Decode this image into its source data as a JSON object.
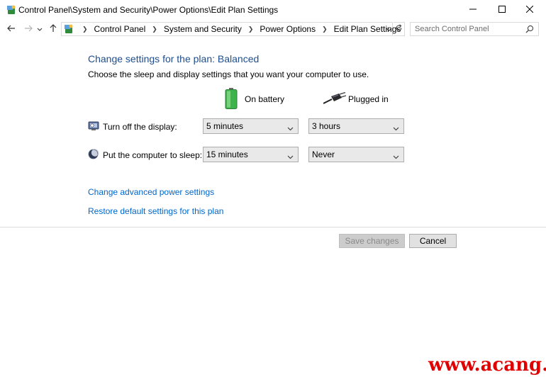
{
  "window": {
    "title": "Control Panel\\System and Security\\Power Options\\Edit Plan Settings",
    "app_icon": "control-panel-icon",
    "minimize_icon": "minimize-icon",
    "maximize_icon": "maximize-icon",
    "close_icon": "close-icon"
  },
  "navigation": {
    "back_icon": "arrow-left-icon",
    "forward_icon": "arrow-right-icon",
    "recent_icon": "chevron-down-icon",
    "up_icon": "arrow-up-icon",
    "breadcrumbs": [
      "Control Panel",
      "System and Security",
      "Power Options",
      "Edit Plan Settings"
    ],
    "refresh_icon": "refresh-icon",
    "search_placeholder": "Search Control Panel",
    "search_value": ""
  },
  "content": {
    "heading": "Change settings for the plan: Balanced",
    "description": "Choose the sleep and display settings that you want your computer to use.",
    "columns": {
      "battery": "On battery",
      "plugged": "Plugged in"
    },
    "rows": {
      "display": {
        "label": "Turn off the display:",
        "battery_value": "5 minutes",
        "plugged_value": "3 hours"
      },
      "sleep": {
        "label": "Put the computer to sleep:",
        "battery_value": "15 minutes",
        "plugged_value": "Never"
      }
    },
    "links": {
      "advanced": "Change advanced power settings",
      "restore": "Restore default settings for this plan"
    }
  },
  "footer": {
    "save_label": "Save changes",
    "cancel_label": "Cancel"
  },
  "watermark": "www.acang.cn",
  "colors": {
    "heading": "#1e4e8c",
    "link": "#0066cc",
    "watermark": "#e00000"
  }
}
